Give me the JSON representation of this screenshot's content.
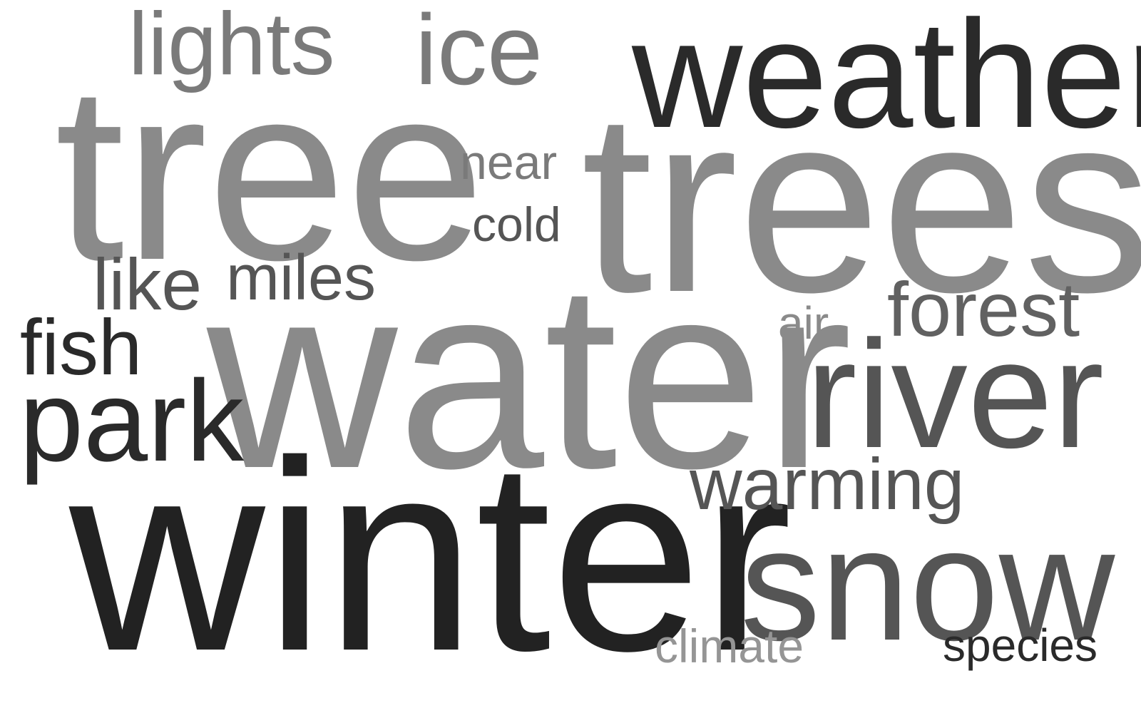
{
  "word_cloud": {
    "words": {
      "winter": "winter",
      "water": "water",
      "trees": "trees",
      "tree": "tree",
      "weather": "weather",
      "snow": "snow",
      "river": "river",
      "park": "park",
      "lights": "lights",
      "ice": "ice",
      "forest": "forest",
      "warming": "warming",
      "fish": "fish",
      "like": "like",
      "miles": "miles",
      "near": "near",
      "cold": "cold",
      "air": "air",
      "climate": "climate",
      "species": "species"
    },
    "colors": {
      "dark": "#222222",
      "mid": "#555555",
      "gray": "#7a7a7a",
      "light": "#8a8a8a",
      "background": "#ffffff"
    }
  }
}
